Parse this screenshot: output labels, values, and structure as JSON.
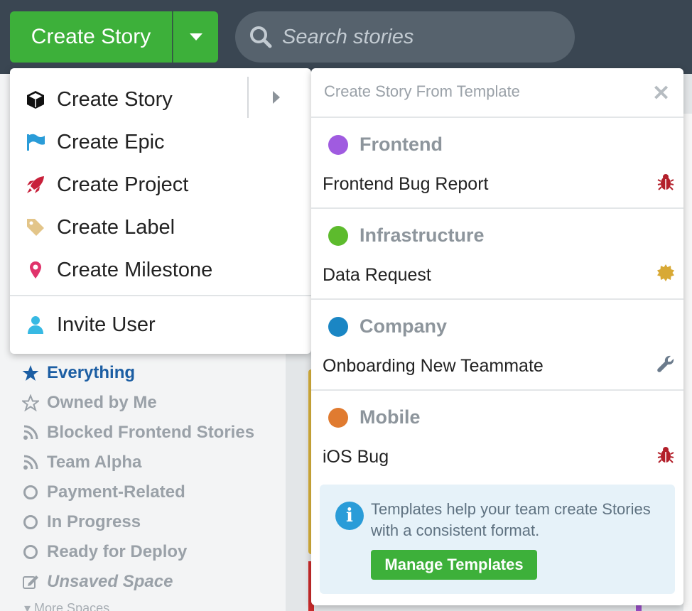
{
  "topbar": {
    "create_story_label": "Create Story",
    "search_placeholder": "Search stories"
  },
  "create_menu": {
    "items": [
      {
        "label": "Create Story",
        "icon": "cube-icon"
      },
      {
        "label": "Create Epic",
        "icon": "flag-icon"
      },
      {
        "label": "Create Project",
        "icon": "rocket-icon"
      },
      {
        "label": "Create Label",
        "icon": "tag-icon"
      },
      {
        "label": "Create Milestone",
        "icon": "map-pin-icon"
      }
    ],
    "invite_label": "Invite User"
  },
  "template_panel": {
    "title": "Create Story From Template",
    "groups": [
      {
        "name": "Frontend",
        "color": "#a05be0",
        "template": "Frontend Bug Report",
        "template_icon": "bug-icon"
      },
      {
        "name": "Infrastructure",
        "color": "#5dbb2d",
        "template": "Data Request",
        "template_icon": "badge-icon"
      },
      {
        "name": "Company",
        "color": "#1a86c4",
        "template": "Onboarding New Teammate",
        "template_icon": "wrench-icon"
      },
      {
        "name": "Mobile",
        "color": "#e07b30",
        "template": "iOS Bug",
        "template_icon": "bug-icon"
      }
    ],
    "info_text": "Templates help your team create Stories with a consistent format.",
    "manage_button": "Manage Templates"
  },
  "sidebar": {
    "spaces": [
      {
        "label": "Everything",
        "icon": "star-filled-icon",
        "active": true
      },
      {
        "label": "Owned by Me",
        "icon": "star-outline-icon"
      },
      {
        "label": "Blocked Frontend Stories",
        "icon": "feed-icon"
      },
      {
        "label": "Team Alpha",
        "icon": "feed-icon"
      },
      {
        "label": "Payment-Related",
        "icon": "circle-icon"
      },
      {
        "label": "In Progress",
        "icon": "circle-icon"
      },
      {
        "label": "Ready for Deploy",
        "icon": "circle-icon"
      },
      {
        "label": "Unsaved Space",
        "icon": "edit-icon"
      }
    ],
    "more_spaces": "More Spaces"
  },
  "colors": {
    "accent_green": "#3db03a",
    "topbar_bg": "#3a4652",
    "active_blue": "#1c5ea3"
  }
}
